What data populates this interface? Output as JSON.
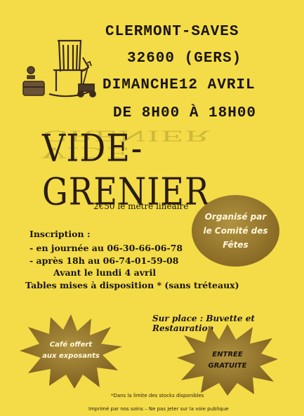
{
  "header": {
    "line1": "CLERMONT-SAVES",
    "line2": "32600 (GERS)",
    "line3": "DIMANCHE12 AVRIL",
    "line4": "DE 8H00 À 18H00"
  },
  "title": "VIDE-GRENIER",
  "price": "2€50 le mètre linéaire",
  "organizer": {
    "line1": "Organisé par",
    "line2": "le Comité des",
    "line3": "Fêtes"
  },
  "inscription": {
    "heading": "Inscription :",
    "day": "- en journée au 06-30-66-06-78",
    "evening": "- après 18h au 06-74-01-59-08",
    "deadline": "Avant le lundi 4 avril",
    "tables": "Tables mises à disposition * (sans tréteaux)"
  },
  "onsite": "Sur place : Buvette et Restauration",
  "star_left": {
    "line1": "Café offert",
    "line2": "aux exposants"
  },
  "star_right": {
    "line1": "ENTREE",
    "line2": "GRATUITE"
  },
  "footnote": "*Dans la limite des stocks disponibles",
  "printer": "Imprimé par nos soins – Ne pas jeter sur la voie publique",
  "colors": {
    "background": "#f3dc47",
    "accent": "#8a6b25",
    "text": "#1a1410"
  }
}
